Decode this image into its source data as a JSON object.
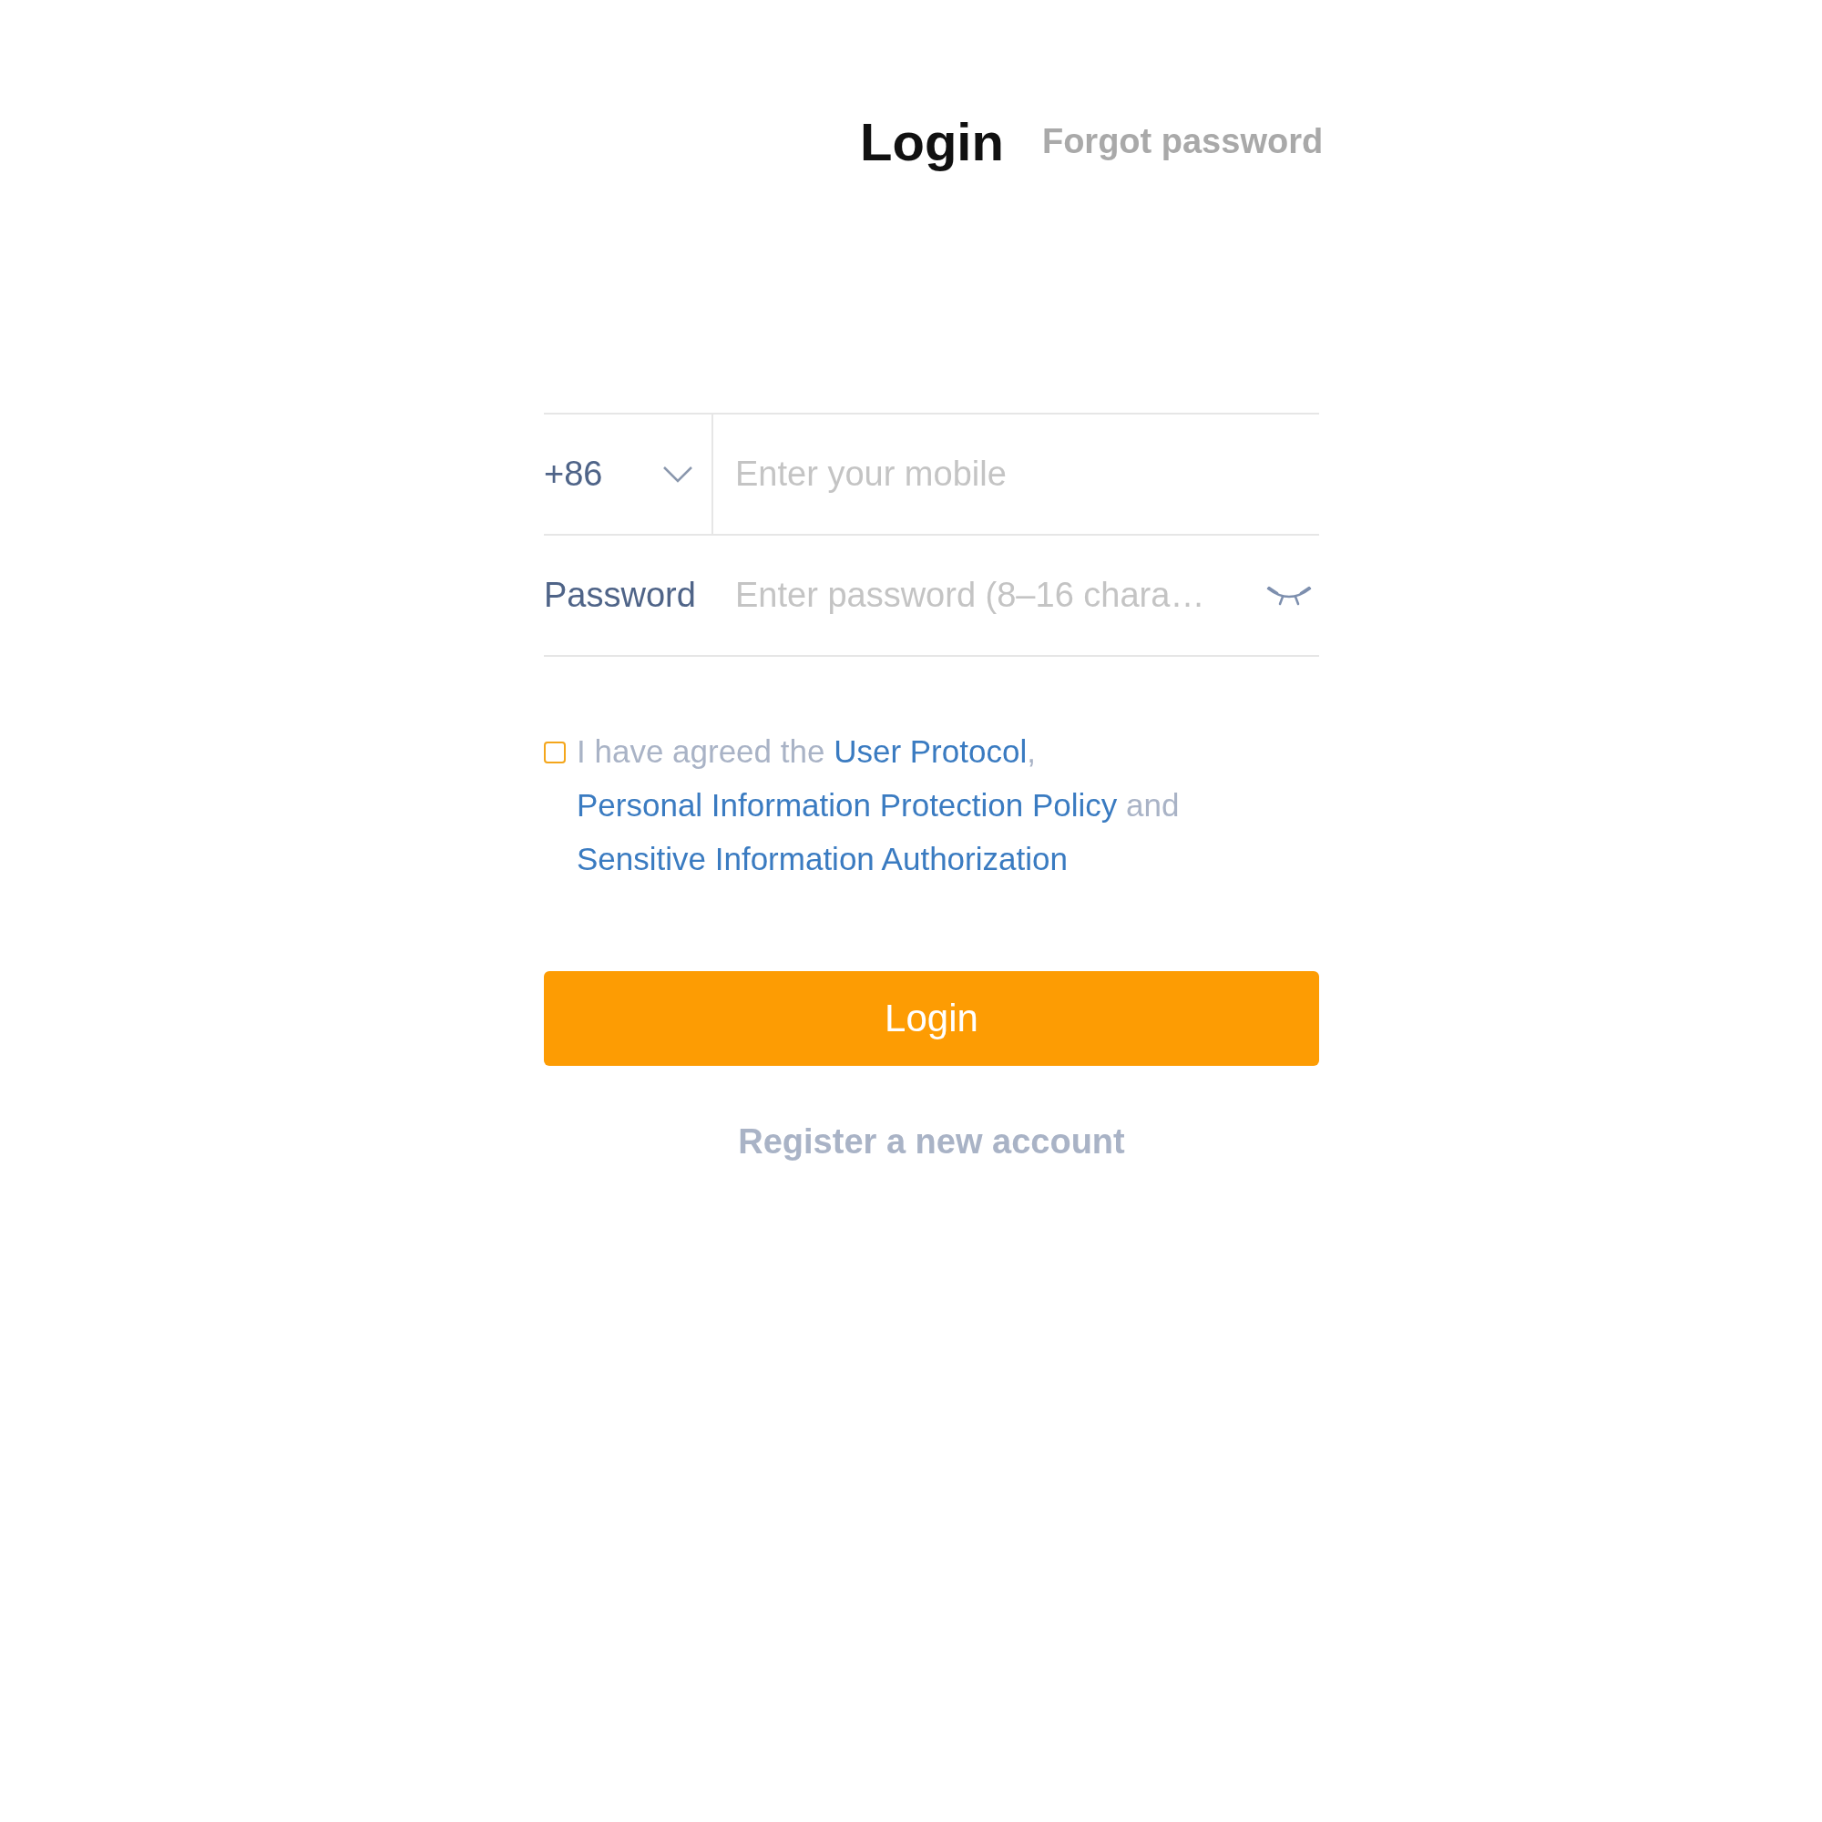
{
  "header": {
    "title": "Login",
    "forgot_link": "Forgot password"
  },
  "phone_row": {
    "country_code": "+86",
    "placeholder": "Enter your mobile"
  },
  "password_row": {
    "label": "Password",
    "placeholder": "Enter password (8–16 chara…",
    "visible": false
  },
  "agreement": {
    "checked": false,
    "parts": [
      {
        "kind": "text",
        "text": "I have agreed the "
      },
      {
        "kind": "link",
        "text": "User Protocol"
      },
      {
        "kind": "text",
        "text": ", "
      },
      {
        "kind": "link",
        "text": "Personal Information Protection Policy"
      },
      {
        "kind": "text",
        "text": " and "
      },
      {
        "kind": "link",
        "text": "Sensitive Information Authorization"
      }
    ]
  },
  "login_button": "Login",
  "register_link": "Register a new account"
}
